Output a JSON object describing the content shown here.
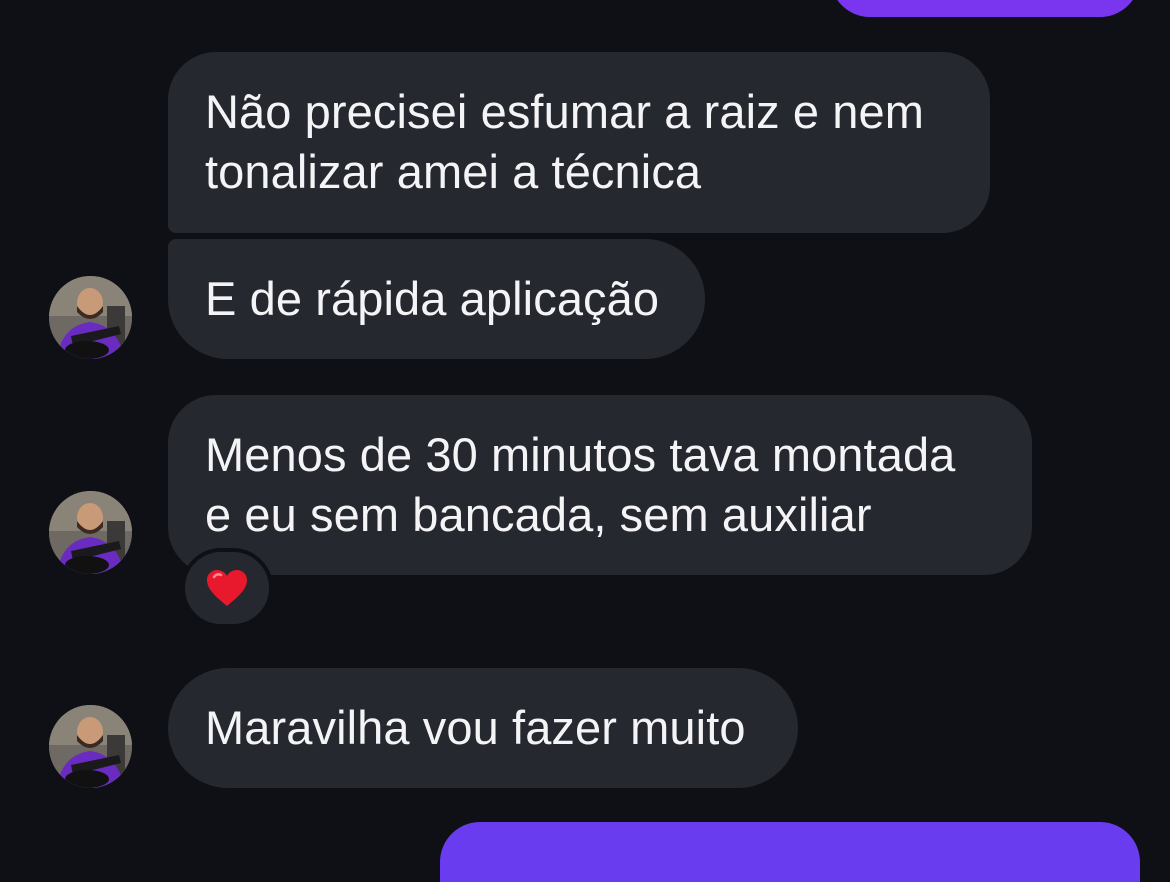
{
  "colors": {
    "background": "#0e1015",
    "incoming_bubble": "#262830",
    "outgoing_bubble": "#7a35ee",
    "text": "#f4f4f6",
    "reaction_heart": "#e8192c"
  },
  "messages": [
    {
      "text_lines": [
        "Não precisei esfumar a raiz e nem",
        "tonalizar amei a técnica"
      ]
    },
    {
      "text_lines": [
        "E de rápida aplicação"
      ]
    },
    {
      "text_lines": [
        "Menos de 30 minutos tava montada",
        "e eu sem bancada, sem auxiliar"
      ],
      "reaction": "heart-icon"
    },
    {
      "text_lines": [
        "Maravilha vou fazer muito"
      ]
    }
  ],
  "avatar": {
    "icon": "profile-photo"
  }
}
